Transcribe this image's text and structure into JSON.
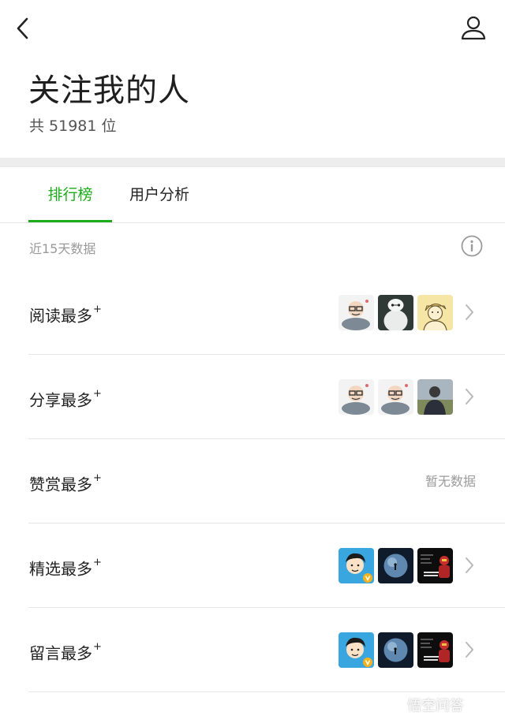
{
  "header": {
    "title": "关注我的人",
    "count_text": "共 51981 位"
  },
  "tabs": [
    {
      "label": "排行榜",
      "active": true
    },
    {
      "label": "用户分析",
      "active": false
    }
  ],
  "period_label": "近15天数据",
  "rankings": [
    {
      "label": "阅读最多",
      "suffix": "+",
      "avatars": [
        "bald-man-avatar",
        "white-robot-avatar",
        "cartoon-sketch-avatar"
      ]
    },
    {
      "label": "分享最多",
      "suffix": "+",
      "avatars": [
        "bald-man-avatar",
        "bald-man-avatar",
        "person-photo-avatar"
      ]
    },
    {
      "label": "赞赏最多",
      "suffix": "+",
      "empty_text": "暂无数据"
    },
    {
      "label": "精选最多",
      "suffix": "+",
      "avatars": [
        "cartoon-boy-verified-avatar",
        "earth-night-avatar",
        "ironman-meme-avatar"
      ]
    },
    {
      "label": "留言最多",
      "suffix": "+",
      "avatars": [
        "cartoon-boy-verified-avatar",
        "earth-night-avatar",
        "ironman-meme-avatar"
      ]
    }
  ],
  "watermark": {
    "text": "悟空问答"
  },
  "colors": {
    "accent": "#1aad19",
    "separator": "#ededed"
  }
}
